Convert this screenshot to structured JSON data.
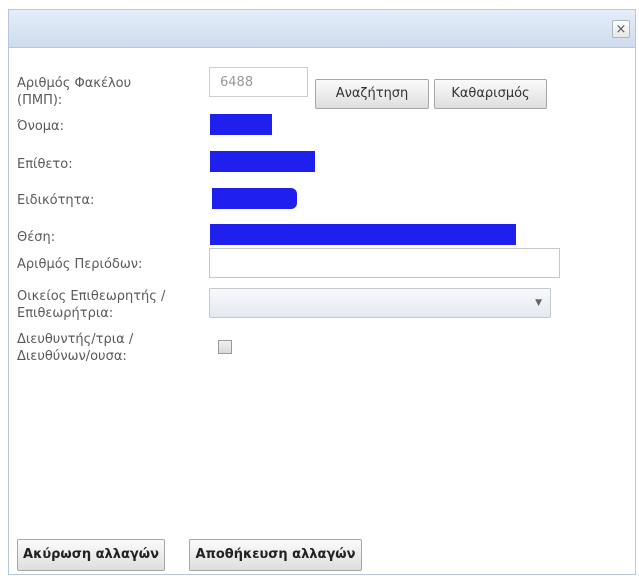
{
  "dialog": {
    "close_symbol": "×",
    "close_icon": "close-icon"
  },
  "form": {
    "file_number_label_line1": "Αριθμός Φακέλου",
    "file_number_label_line2": "(ΠΜΠ):",
    "file_number_value": "6488",
    "search_label": "Αναζήτηση",
    "clear_label": "Καθαρισμός",
    "name_label": "Όνομα:",
    "surname_label": "Επίθετο:",
    "specialty_label": "Ειδικότητα:",
    "position_label": "Θέση:",
    "periods_label": "Αριθμός Περιόδων:",
    "periods_value": "",
    "inspector_label_line1": "Οικείος Επιθεωρητής /",
    "inspector_label_line2": "Επιθεωρήτρια:",
    "inspector_selected": "",
    "director_label_line1": "Διευθυντής/τρια /",
    "director_label_line2": "Διευθύνων/ουσα:",
    "director_checked": false,
    "redaction_color": "#2020ee"
  },
  "footer": {
    "cancel_label": "Ακύρωση αλλαγών",
    "save_label": "Αποθήκευση αλλαγών"
  }
}
